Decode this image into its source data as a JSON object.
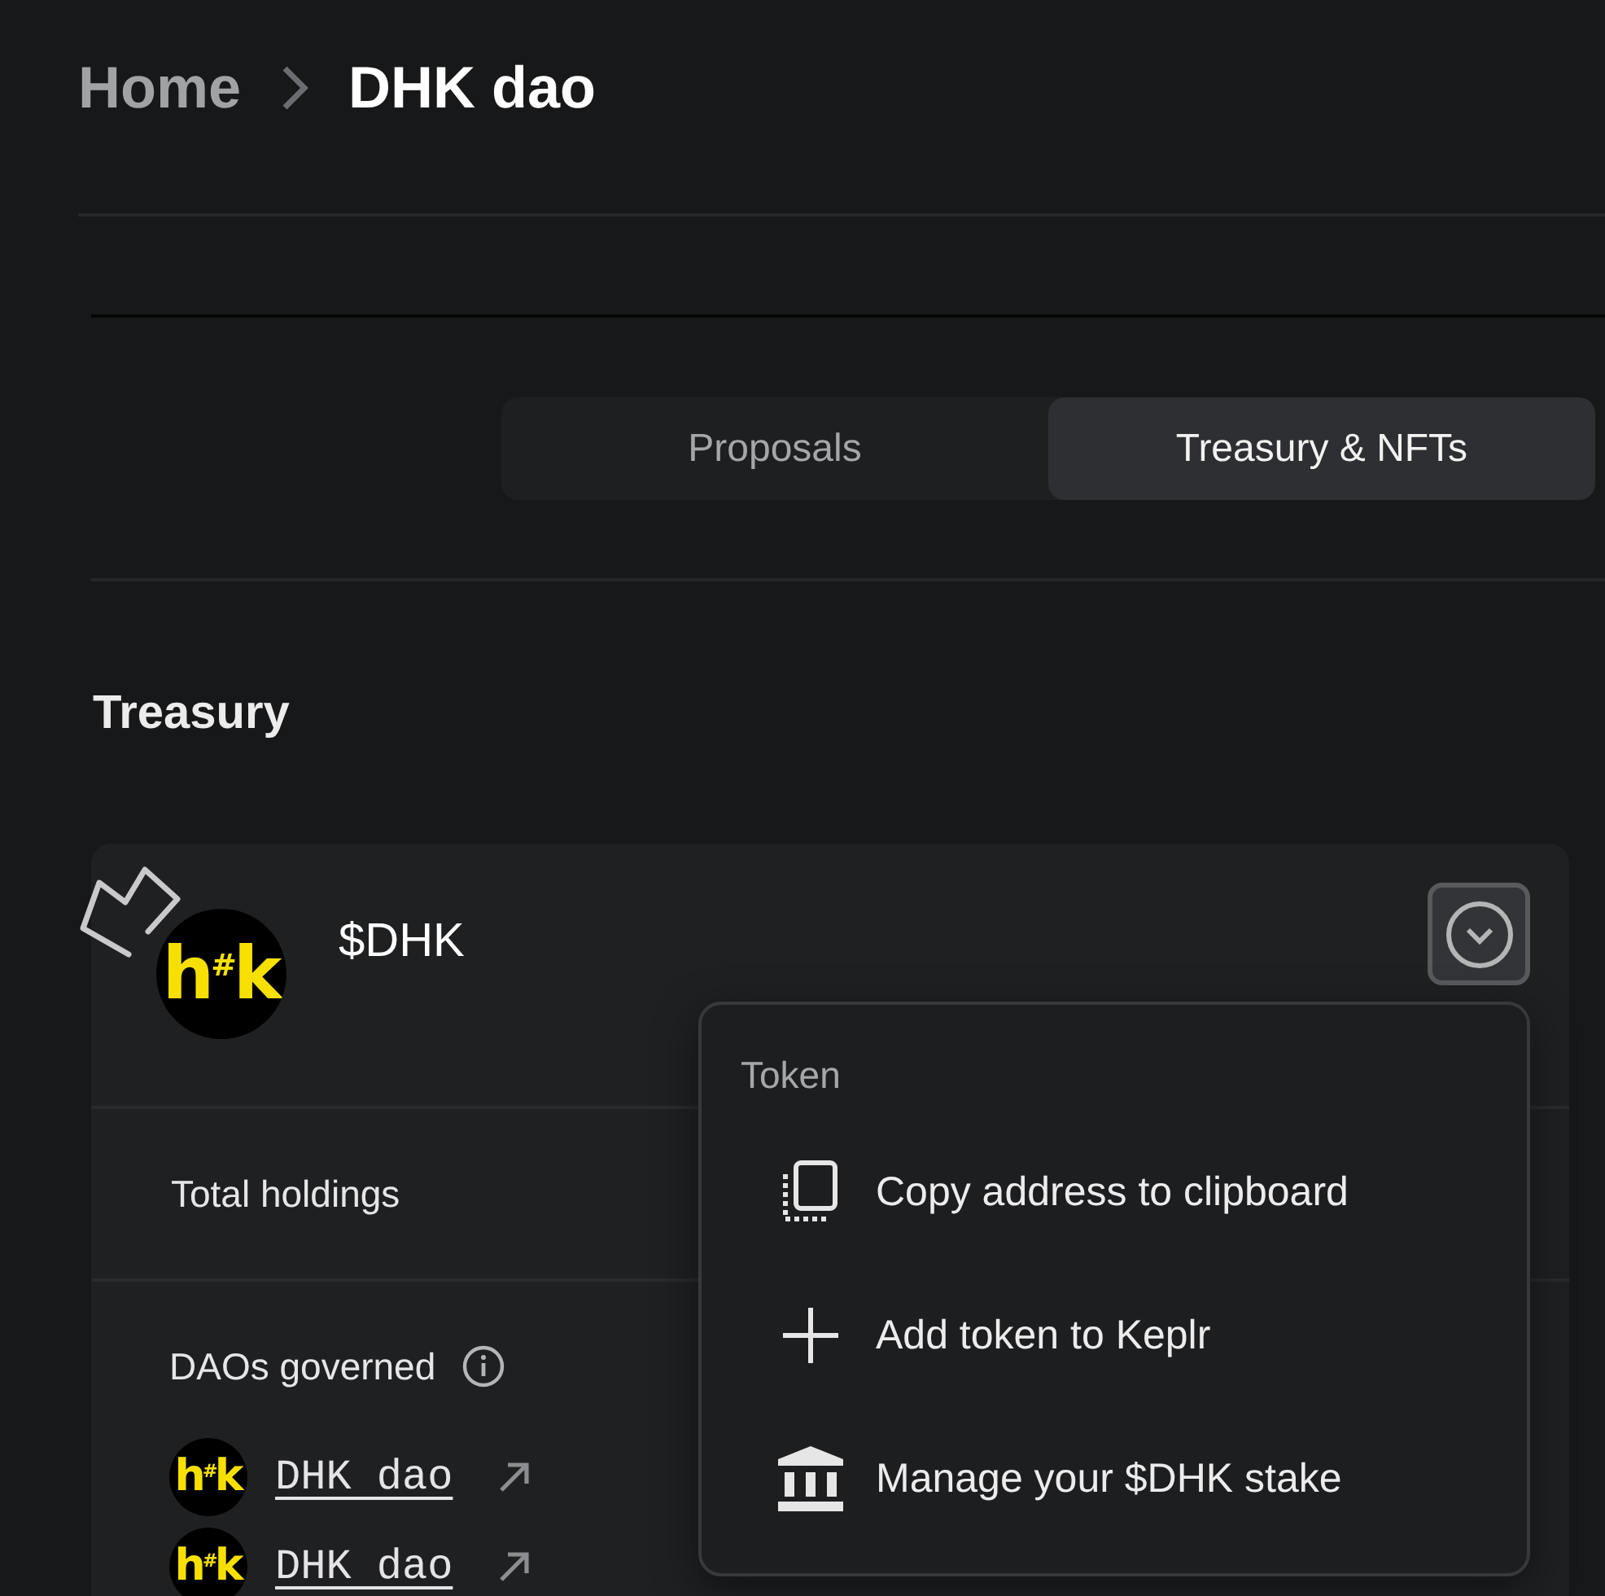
{
  "breadcrumb": [
    {
      "label": "Home",
      "current": false
    },
    {
      "label": "DHK dao",
      "current": true
    }
  ],
  "tabs": [
    {
      "label": "Proposals",
      "selected": false
    },
    {
      "label": "Treasury & NFTs",
      "selected": true
    }
  ],
  "treasury": {
    "title": "Treasury",
    "token": {
      "logo": "h$^{#}$k",
      "symbol": "$DHK",
      "expanded": true,
      "rows": [
        {
          "kind": "plain",
          "label": "Total holdings"
        },
        {
          "kind": "daos",
          "label": "DAOs governed",
          "daos": [
            {
              "logo": "h$^{#}$k",
              "name": "DHK dao"
            },
            {
              "logo": "h$^{#}$k",
              "name": "DHK dao"
            }
          ]
        }
      ],
      "menu": {
        "title": "Token",
        "items": [
          {
            "kind": "copy",
            "label": "Copy address to clipboard"
          },
          {
            "kind": "add",
            "label": "Add token to Keplr"
          },
          {
            "kind": "stake",
            "label": "Manage your $DHK stake"
          }
        ]
      }
    }
  }
}
